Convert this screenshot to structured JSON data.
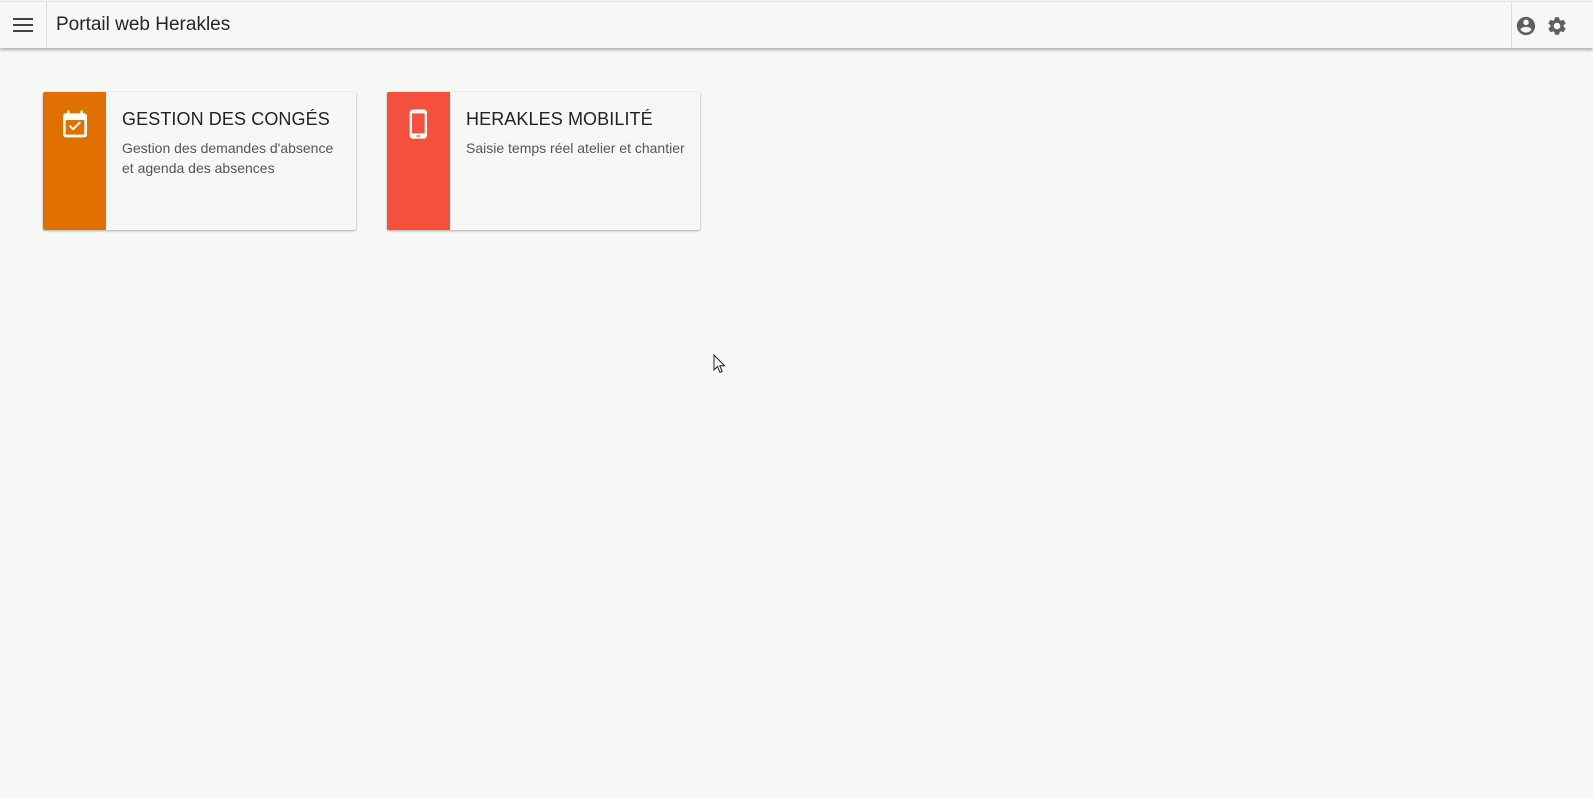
{
  "header": {
    "title": "Portail web Herakles",
    "menu_icon": "menu-icon",
    "account_icon": "account-circle-icon",
    "settings_icon": "gear-icon"
  },
  "tiles": [
    {
      "title": "GESTION DES CONGÉS",
      "description": "Gestion des demandes d'absence et agenda des absences",
      "icon": "calendar-check-icon",
      "color": "#e07000"
    },
    {
      "title": "HERAKLES MOBILITÉ",
      "description": "Saisie temps réel atelier et chantier",
      "icon": "smartphone-icon",
      "color": "#f5503c"
    }
  ],
  "colors": {
    "background": "#f6f8f6",
    "icon_gray": "#5f5f5f"
  }
}
